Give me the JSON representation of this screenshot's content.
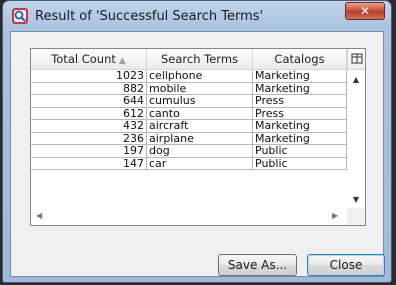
{
  "window": {
    "title": "Result of 'Successful Search Terms'",
    "close_glyph": "✕"
  },
  "table": {
    "columns": [
      {
        "label": "Total Count",
        "sorted": "ascending"
      },
      {
        "label": "Search Terms"
      },
      {
        "label": "Catalogs"
      }
    ],
    "sort_glyph": "▲",
    "rows": [
      [
        "1023",
        "cellphone",
        "Marketing"
      ],
      [
        "882",
        "mobile",
        "Marketing"
      ],
      [
        "644",
        "cumulus",
        "Press"
      ],
      [
        "612",
        "canto",
        "Press"
      ],
      [
        "432",
        "aircraft",
        "Marketing"
      ],
      [
        "236",
        "airplane",
        "Marketing"
      ],
      [
        "197",
        "dog",
        "Public"
      ],
      [
        "147",
        "car",
        "Public"
      ]
    ]
  },
  "scroll": {
    "up": "▲",
    "down": "▼",
    "left": "◀",
    "right": "▶"
  },
  "buttons": {
    "save_as": "Save As...",
    "close": "Close"
  },
  "colors": {
    "title_bar": "#bfd4ec",
    "close_button": "#c74a32",
    "default_button_border": "#3c7fb1"
  },
  "icons": {
    "app": "search-result-icon",
    "column_picker": "column-picker-icon"
  }
}
